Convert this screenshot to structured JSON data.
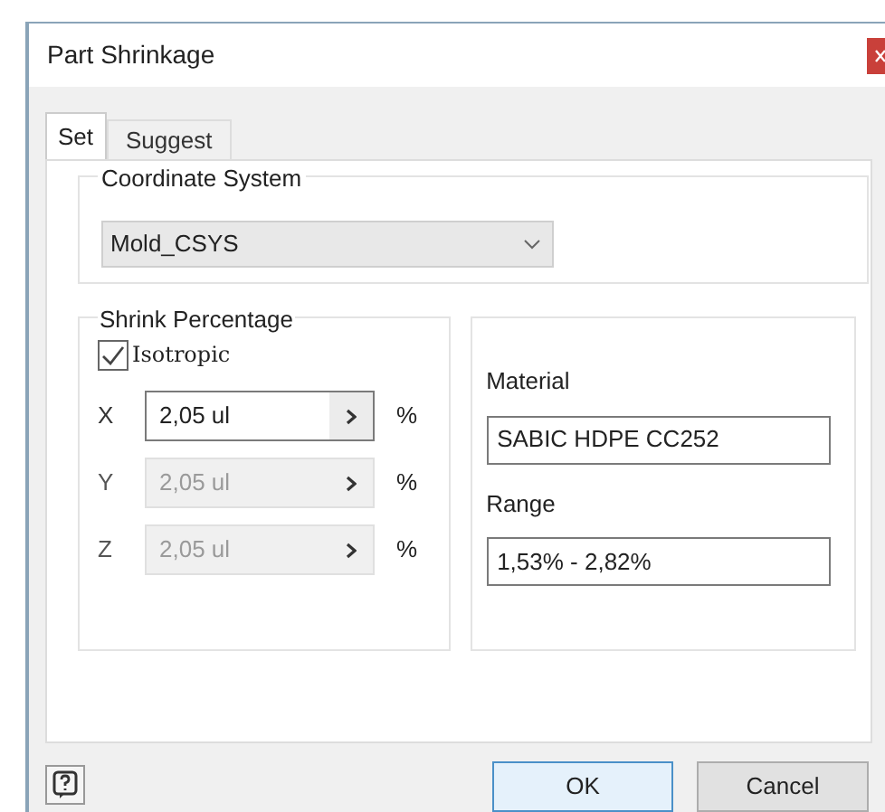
{
  "window": {
    "title": "Part Shrinkage"
  },
  "tabs": [
    {
      "label": "Set",
      "selected": true
    },
    {
      "label": "Suggest",
      "selected": false
    }
  ],
  "coordinate_system": {
    "label": "Coordinate System",
    "value": "Mold_CSYS"
  },
  "shrink_percentage": {
    "label": "Shrink Percentage",
    "isotropic": {
      "label": "Isotropic",
      "checked": true
    },
    "axes": [
      {
        "axis": "X",
        "value": "2,05 ul",
        "unit": "%",
        "disabled": false
      },
      {
        "axis": "Y",
        "value": "2,05 ul",
        "unit": "%",
        "disabled": true
      },
      {
        "axis": "Z",
        "value": "2,05 ul",
        "unit": "%",
        "disabled": true
      }
    ]
  },
  "material": {
    "label": "Material",
    "value": "SABIC HDPE CC252"
  },
  "range": {
    "label": "Range",
    "value": "1,53% - 2,82%"
  },
  "buttons": [
    {
      "label": "OK",
      "kind": "default"
    },
    {
      "label": "Cancel",
      "kind": "normal"
    }
  ]
}
